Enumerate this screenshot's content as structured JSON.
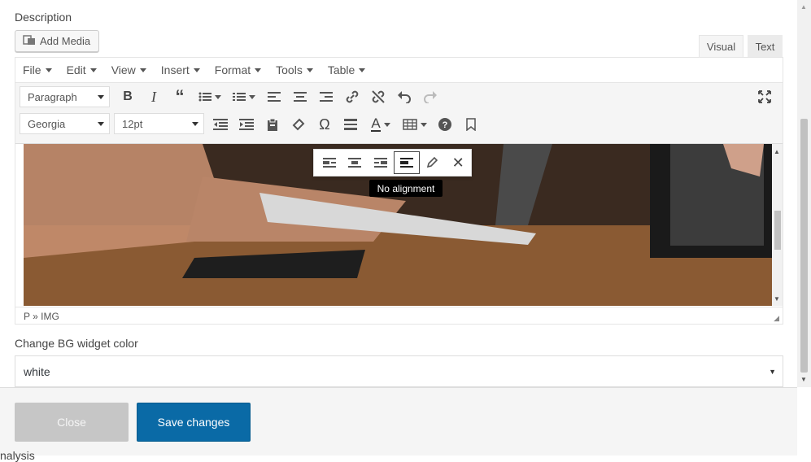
{
  "description_label": "Description",
  "add_media_label": "Add Media",
  "tabs": {
    "visual": "Visual",
    "text": "Text"
  },
  "menubar": [
    "File",
    "Edit",
    "View",
    "Insert",
    "Format",
    "Tools",
    "Table"
  ],
  "toolbar": {
    "paragraph_select": "Paragraph",
    "font_select": "Georgia",
    "size_select": "12pt"
  },
  "image_toolbar": {
    "tooltip": "No alignment"
  },
  "statusbar": {
    "path": "P » IMG"
  },
  "bg_widget": {
    "label": "Change BG widget color",
    "value": "white"
  },
  "footer": {
    "close_label": "Close",
    "save_label": "Save changes"
  },
  "behind_text": "nalysis",
  "colors": {
    "primary": "#0a6aa6",
    "close_bg": "#c6c6c6"
  }
}
